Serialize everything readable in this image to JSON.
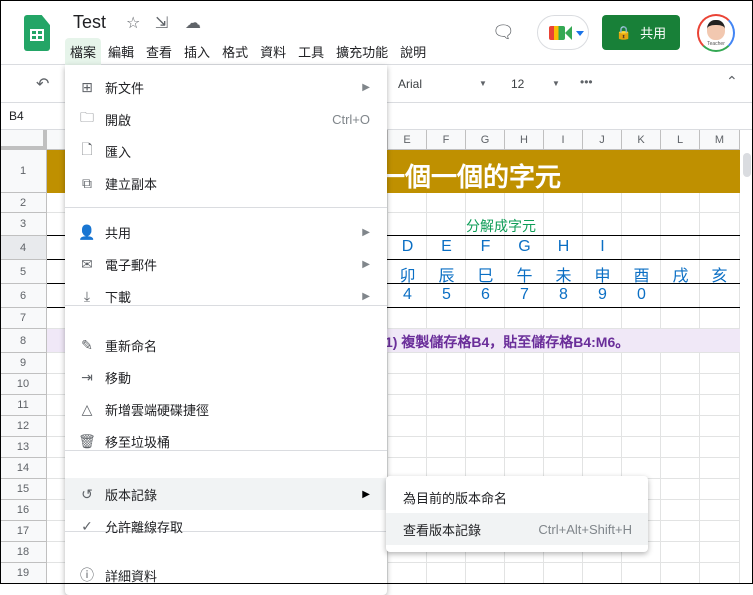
{
  "app": {
    "title": "Test",
    "menus": [
      "檔案",
      "編輯",
      "查看",
      "插入",
      "格式",
      "資料",
      "工具",
      "擴充功能",
      "說明"
    ],
    "share_label": "共用",
    "avatar_text": "Teacher"
  },
  "toolbar": {
    "font": "Arial",
    "font_size": "12",
    "more": "•••"
  },
  "formula_bar": {
    "cell_ref": "B4"
  },
  "sheet": {
    "columns": [
      "E",
      "F",
      "G",
      "H",
      "I",
      "J",
      "K",
      "L",
      "M"
    ],
    "rows": [
      "1",
      "2",
      "3",
      "4",
      "5",
      "6",
      "7",
      "8",
      "9",
      "10",
      "11",
      "12",
      "13",
      "14",
      "15",
      "16",
      "17",
      "18",
      "19"
    ],
    "title_text": "一個一個的字元",
    "subtitle_text": "分解成字元",
    "row4": [
      "D",
      "E",
      "F",
      "G",
      "H",
      "I"
    ],
    "row5": [
      "卯",
      "辰",
      "巳",
      "午",
      "未",
      "申",
      "酉",
      "戌",
      "亥"
    ],
    "row6": [
      "4",
      "5",
      "6",
      "7",
      "8",
      "9",
      "0"
    ],
    "note_text": "1) 複製儲存格B4，貼至儲存格B4:M6。",
    "colors": {
      "title_bg": "#bf9000",
      "note_bg": "#f0e8f7",
      "note_text": "#6a2e9a",
      "values": "#0b6fc4",
      "subtitle": "#0f9d58"
    }
  },
  "file_menu": {
    "items": [
      {
        "label": "新文件",
        "icon": "new-document-icon",
        "glyph": "⊞",
        "arrow": true
      },
      {
        "label": "開啟",
        "icon": "folder-icon",
        "glyph": "🗀",
        "shortcut": "Ctrl+O"
      },
      {
        "label": "匯入",
        "icon": "file-icon",
        "glyph": "🗋"
      },
      {
        "label": "建立副本",
        "icon": "copy-icon",
        "glyph": "⧉"
      },
      {
        "label": "共用",
        "icon": "person-add-icon",
        "glyph": "👤",
        "arrow": true
      },
      {
        "label": "電子郵件",
        "icon": "email-icon",
        "glyph": "✉",
        "arrow": true
      },
      {
        "label": "下載",
        "icon": "download-icon",
        "glyph": "⤓",
        "arrow": true
      },
      {
        "label": "重新命名",
        "icon": "rename-icon",
        "glyph": "✎"
      },
      {
        "label": "移動",
        "icon": "move-folder-icon",
        "glyph": "⇥"
      },
      {
        "label": "新增雲端硬碟捷徑",
        "icon": "drive-shortcut-icon",
        "glyph": "△"
      },
      {
        "label": "移至垃圾桶",
        "icon": "trash-icon",
        "glyph": "🗑"
      },
      {
        "label": "版本記錄",
        "icon": "history-icon",
        "glyph": "↺",
        "arrow": true,
        "highlighted": true
      },
      {
        "label": "允許離線存取",
        "icon": "offline-icon",
        "glyph": "✓"
      },
      {
        "label": "詳細資料",
        "icon": "info-icon",
        "glyph": "ⓘ"
      }
    ],
    "arrow_glyph": "▶"
  },
  "version_submenu": {
    "items": [
      {
        "label": "為目前的版本命名"
      },
      {
        "label": "查看版本記錄",
        "shortcut": "Ctrl+Alt+Shift+H",
        "highlighted": true
      }
    ]
  }
}
